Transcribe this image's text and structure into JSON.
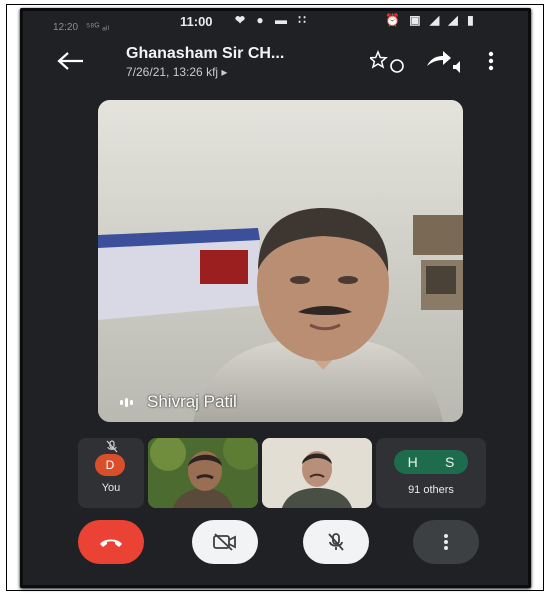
{
  "status_bar": {
    "faint_time": "12:20",
    "faint_signal": "⁵⁸ᴳ ₐₗₗ",
    "time": "11:00",
    "left_icons": "❤ ● ▬ ∷",
    "right_icons": "⏰ ▣ ◢ ◢ ▮"
  },
  "header": {
    "title": "Ghanasham Sir CH...",
    "subtitle": "7/26/21, 13:26  kfj  ▸"
  },
  "main_video": {
    "participant_name": "Shivraj Patil"
  },
  "participants": {
    "self_initial": "D",
    "self_label": "You",
    "others_initials": [
      "H",
      "S"
    ],
    "others_label": "91 others"
  },
  "colors": {
    "end_call": "#ea4335",
    "avatar_d": "#d94f2b",
    "others_badge": "#1e6c4e",
    "background": "#1f2124"
  }
}
